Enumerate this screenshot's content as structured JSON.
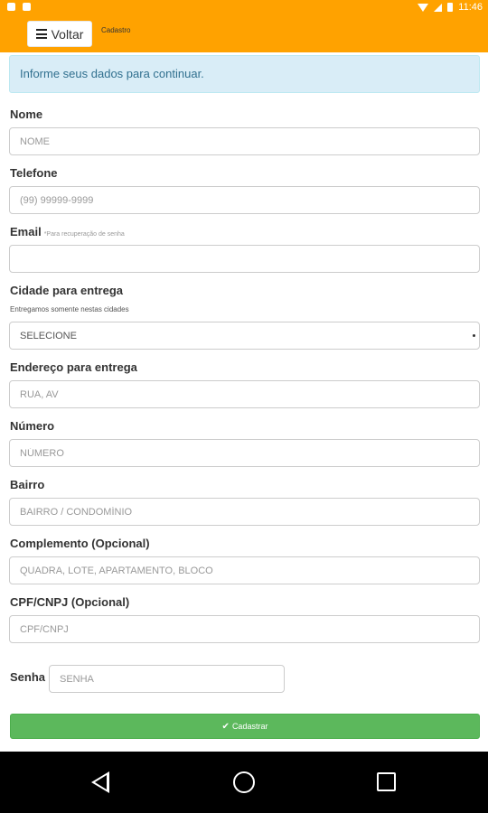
{
  "status_bar": {
    "time": "11:46",
    "icons": [
      "notification-icon",
      "notification-icon-2",
      "wifi-icon",
      "signal-icon",
      "battery-icon"
    ]
  },
  "app_bar": {
    "back_label": "Voltar",
    "title": "Cadastro",
    "accent": "#ffa200"
  },
  "alert": {
    "text": "Informe seus dados para continuar."
  },
  "form": {
    "nome": {
      "label": "Nome",
      "placeholder": "NOME"
    },
    "telefone": {
      "label": "Telefone",
      "placeholder": "(99) 99999-9999"
    },
    "email": {
      "label": "Email",
      "hint": "*Para recuperação de senha",
      "placeholder": ""
    },
    "cidade": {
      "label": "Cidade para entrega",
      "hint": "Entregamos somente nestas cidades",
      "selected": "SELECIONE"
    },
    "endereco": {
      "label": "Endereço para entrega",
      "placeholder": "RUA, AV"
    },
    "numero": {
      "label": "Número",
      "placeholder": "NÚMERO"
    },
    "bairro": {
      "label": "Bairro",
      "placeholder": "BAIRRO / CONDOMÍNIO"
    },
    "complemento": {
      "label": "Complemento (Opcional)",
      "placeholder": "QUADRA, LOTE, APARTAMENTO, BLOCO"
    },
    "cpf": {
      "label": "CPF/CNPJ (Opcional)",
      "placeholder": "CPF/CNPJ"
    },
    "senha": {
      "label": "Senha",
      "placeholder": "SENHA"
    },
    "submit_label": "Cadastrar",
    "submit_color": "#5cb85c"
  }
}
